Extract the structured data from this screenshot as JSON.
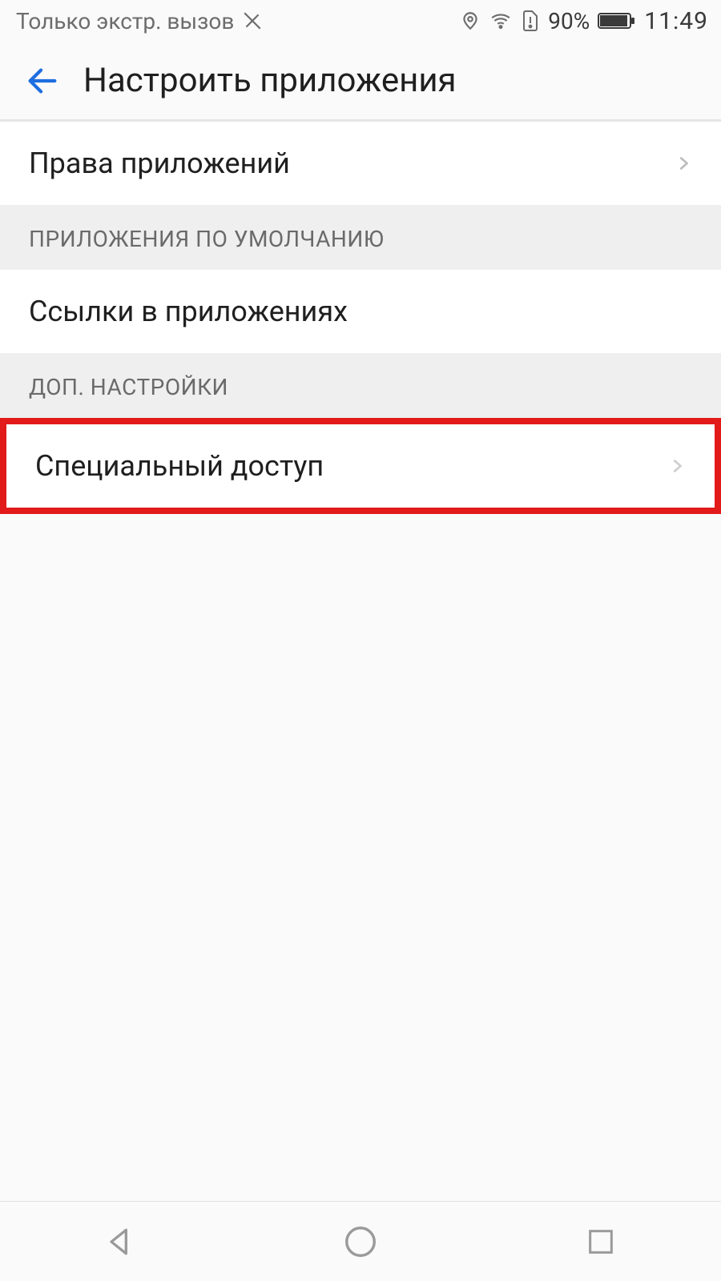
{
  "status": {
    "network_text": "Только экстр. вызов",
    "battery_percent": "90%",
    "clock": "11:49"
  },
  "header": {
    "title": "Настроить приложения"
  },
  "rows": {
    "app_permissions": "Права приложений",
    "app_links": "Ссылки в приложениях",
    "special_access": "Специальный доступ"
  },
  "sections": {
    "default_apps": "ПРИЛОЖЕНИЯ ПО УМОЛЧАНИЮ",
    "advanced": "ДОП. НАСТРОЙКИ"
  },
  "highlight_color": "#e21a1a"
}
